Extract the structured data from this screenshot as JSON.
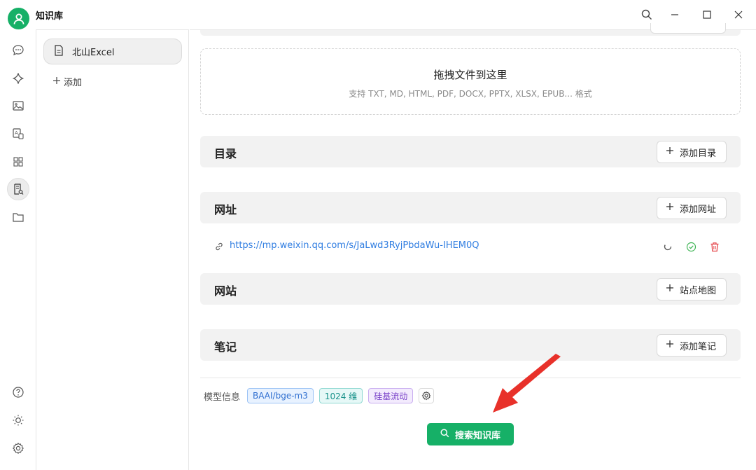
{
  "app": {
    "title": "知识库"
  },
  "titlebar": {
    "icons": [
      "search-icon",
      "minimize-icon",
      "maximize-icon",
      "close-icon"
    ]
  },
  "rail": {
    "top_icons": [
      "chat-icon",
      "sparkle-icon",
      "image-icon",
      "translate-icon",
      "apps-icon",
      "knowledge-icon",
      "folder-icon"
    ],
    "active": "knowledge-icon",
    "bottom_icons": [
      "help-icon",
      "theme-icon",
      "settings-icon"
    ]
  },
  "kb_list": {
    "items": [
      {
        "label": "北山Excel",
        "icon": "document-icon"
      }
    ],
    "add_label": "添加"
  },
  "dropzone": {
    "title": "拖拽文件到这里",
    "hint": "支持 TXT, MD, HTML, PDF, DOCX, PPTX, XLSX, EPUB... 格式"
  },
  "sections": {
    "directory": {
      "title": "目录",
      "button": "添加目录"
    },
    "url": {
      "title": "网址",
      "button": "添加网址"
    },
    "website": {
      "title": "网站",
      "button": "站点地图"
    },
    "notes": {
      "title": "笔记",
      "button": "添加笔记"
    }
  },
  "urls": [
    {
      "link": "https://mp.weixin.qq.com/s/JaLwd3RyjPbdaWu-IHEM0Q",
      "actions": [
        "refresh-icon",
        "check-circle-icon",
        "trash-icon"
      ]
    }
  ],
  "model": {
    "label": "模型信息",
    "tags": [
      "BAAI/bge-m3",
      "1024 维",
      "硅基流动"
    ]
  },
  "search_button": "搜索知识库",
  "colors": {
    "accent": "#16b067",
    "link": "#2f7de1",
    "danger": "#e5484d",
    "arrow": "#e8312a"
  }
}
